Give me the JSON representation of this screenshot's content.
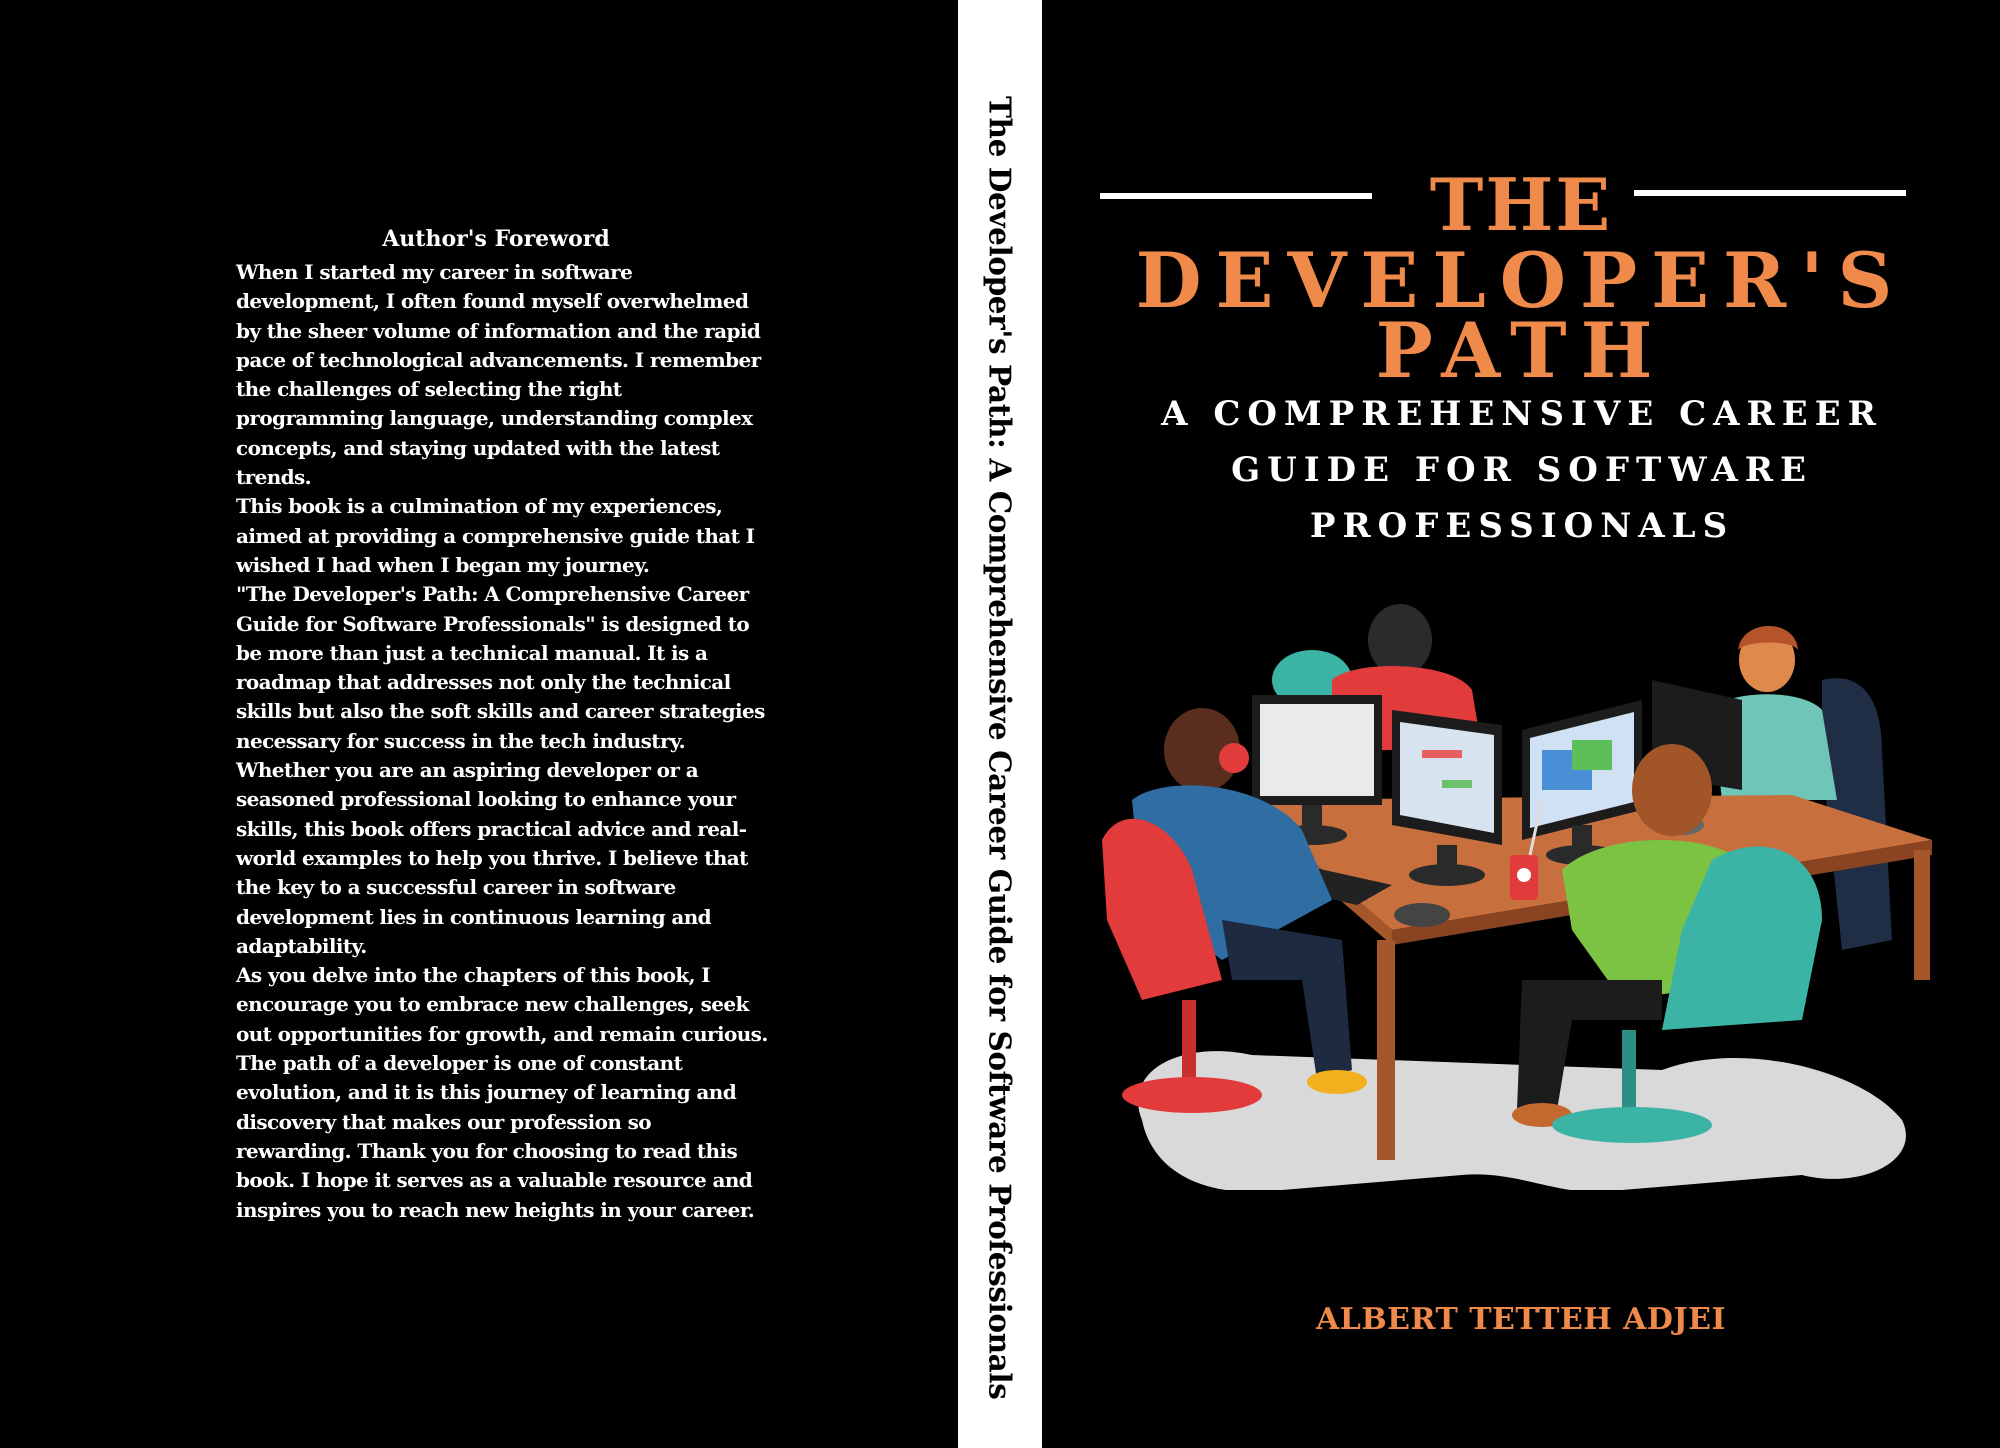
{
  "back_cover": {
    "foreword_title": "Author's Foreword",
    "paragraphs": [
      "When I started my career in software development, I often found myself overwhelmed by the sheer volume of information and the rapid pace of technological advancements. I remember the challenges of selecting the right programming language, understanding complex concepts, and staying updated with the latest trends.",
      "This book is a culmination of my experiences, aimed at providing a comprehensive guide that I wished I had when I began my journey.",
      "\"The Developer's Path: A Comprehensive Career Guide for Software Professionals\" is designed to be more than just a technical manual. It is a roadmap that addresses not only the technical skills but also the soft skills and career strategies necessary for success in the tech industry.",
      "Whether you are an aspiring developer or a seasoned professional looking to enhance your skills, this book offers practical advice and real-world examples to help you thrive. I believe that the key to a successful career in software development lies in continuous learning and adaptability.",
      "As you delve into the chapters of this book, I encourage you to embrace new challenges, seek out opportunities for growth, and remain curious. The path of a developer is one of constant evolution, and it is this journey of learning and discovery that makes our profession so rewarding. Thank you for choosing to read this book. I hope it serves as a valuable resource and inspires you to reach new heights in your career."
    ]
  },
  "spine": {
    "text": "The Developer's Path: A Comprehensive Career Guide for Software Professionals"
  },
  "front_cover": {
    "title_lines": [
      "THE",
      "DEVELOPER'S",
      "PATH"
    ],
    "subtitle_lines": [
      "A COMPREHENSIVE CAREER",
      "GUIDE FOR SOFTWARE",
      "PROFESSIONALS"
    ],
    "author": "ALBERT TETTEH ADJEI"
  },
  "colors": {
    "background": "#000000",
    "accent_orange": "#f08a4b",
    "text_white": "#ffffff"
  }
}
